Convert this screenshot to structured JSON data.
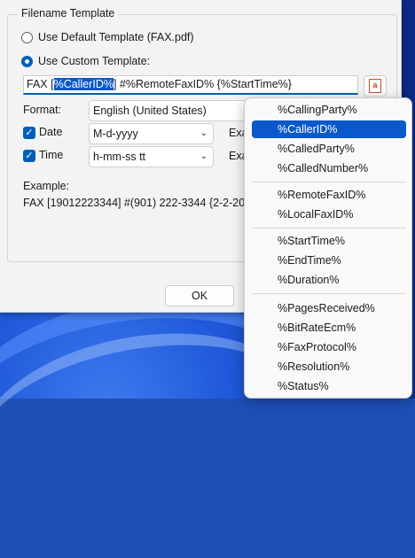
{
  "dialog": {
    "group_title": "Filename Template",
    "radio_default": "Use Default Template (FAX.pdf)",
    "radio_custom": "Use Custom Template:",
    "template_prefix": "FAX [",
    "template_selected": "%CallerID%",
    "template_suffix": "] #%RemoteFaxID% {%StartTime%}",
    "insert_button_glyph": "a",
    "format_label": "Format:",
    "format_value": "English (United States)",
    "date_label": "Date",
    "date_value": "M-d-yyyy",
    "time_label": "Time",
    "time_value": "h-mm-ss tt",
    "example_clipped_1": "Exa",
    "example_clipped_2": "Exa",
    "example_label": "Example:",
    "example_value": "FAX [19012223344] #(901) 222-3344 {2-2-202",
    "ok_label": "OK"
  },
  "menu": {
    "items": [
      "%CallingParty%",
      "%CallerID%",
      "%CalledParty%",
      "%CalledNumber%",
      "%RemoteFaxID%",
      "%LocalFaxID%",
      "%StartTime%",
      "%EndTime%",
      "%Duration%",
      "%PagesReceived%",
      "%BitRateEcm%",
      "%FaxProtocol%",
      "%Resolution%",
      "%Status%"
    ],
    "highlighted": "%CallerID%"
  },
  "colors": {
    "accent": "#005fb8",
    "selection": "#0a58c9"
  }
}
